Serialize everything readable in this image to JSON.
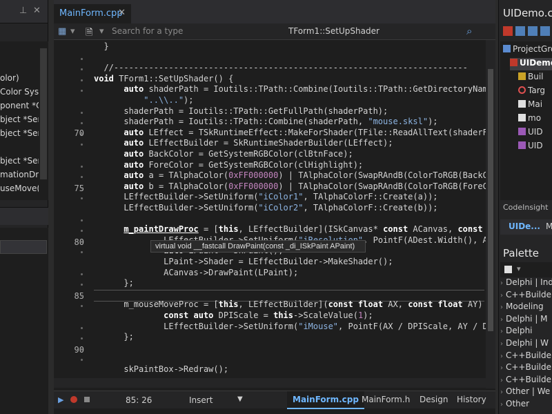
{
  "left_panel": {
    "pin_icon": "pin-icon",
    "close_icon": "close-icon",
    "items": [
      "olor)",
      "Color  Syste",
      "ponent  *Ov",
      "bject  *Sen",
      "bject  *Send",
      "bject  *Send",
      "mationDraw",
      "useMove(T"
    ]
  },
  "editor": {
    "tab_label": "MainForm.cpp",
    "search_placeholder": "Search for a type",
    "method_label": "TForm1::SetUpShader",
    "tooltip": "virtual void __fastcall DrawPaint(const _di_ISkPaint APaint)",
    "line_numbers": [
      "70",
      "75",
      "80",
      "85",
      "90"
    ]
  },
  "code_lines": [
    {
      "segs": [
        [
          "",
          "  }"
        ]
      ]
    },
    {
      "segs": [
        [
          "",
          ""
        ]
      ]
    },
    {
      "segs": [
        [
          "",
          "  //-----------------------------------------------------------------------"
        ]
      ]
    },
    {
      "segs": [
        [
          "kw",
          "void"
        ],
        [
          "",
          " TForm1::SetUpShader() {"
        ]
      ]
    },
    {
      "segs": [
        [
          "",
          "      "
        ],
        [
          "kw",
          "auto"
        ],
        [
          "",
          " shaderPath = Ioutils::TPath::Combine(Ioutils::TPath::GetDirectoryNam"
        ]
      ]
    },
    {
      "segs": [
        [
          "",
          "          "
        ],
        [
          "str",
          "\"..\\\\..\""
        ],
        [
          "",
          ");"
        ]
      ]
    },
    {
      "segs": [
        [
          "",
          "      shaderPath = Ioutils::TPath::GetFullPath(shaderPath);"
        ]
      ]
    },
    {
      "segs": [
        [
          "",
          "      shaderPath = Ioutils::TPath::Combine(shaderPath, "
        ],
        [
          "str",
          "\"mouse.sksl\""
        ],
        [
          "",
          ");"
        ]
      ]
    },
    {
      "segs": [
        [
          "",
          "      "
        ],
        [
          "kw",
          "auto"
        ],
        [
          "",
          " LEffect = TSkRuntimeEffect::MakeForShader(TFile::ReadAllText(shaderF"
        ]
      ]
    },
    {
      "segs": [
        [
          "",
          "      "
        ],
        [
          "kw",
          "auto"
        ],
        [
          "",
          " LEffectBuilder = SkRuntimeShaderBuilder(LEffect);"
        ]
      ]
    },
    {
      "segs": [
        [
          "",
          "      "
        ],
        [
          "kw",
          "auto"
        ],
        [
          "",
          " BackColor = GetSystemRGBColor(clBtnFace);"
        ]
      ]
    },
    {
      "segs": [
        [
          "",
          "      "
        ],
        [
          "kw",
          "auto"
        ],
        [
          "",
          " ForeColor = GetSystemRGBColor(clHighlight);"
        ]
      ]
    },
    {
      "segs": [
        [
          "",
          "      "
        ],
        [
          "kw",
          "auto"
        ],
        [
          "",
          " a = TAlphaColor("
        ],
        [
          "num",
          "0xFF000000"
        ],
        [
          "",
          ") | TAlphaColor(SwapRAndB(ColorToRGB(BackC"
        ]
      ]
    },
    {
      "segs": [
        [
          "",
          "      "
        ],
        [
          "kw",
          "auto"
        ],
        [
          "",
          " b = TAlphaColor("
        ],
        [
          "num",
          "0xFF000000"
        ],
        [
          "",
          ") | TAlphaColor(SwapRAndB(ColorToRGB(ForeC"
        ]
      ]
    },
    {
      "segs": [
        [
          "",
          "      LEffectBuilder->SetUniform("
        ],
        [
          "str",
          "\"iColor1\""
        ],
        [
          "",
          ", TAlphaColorF::Create(a));"
        ]
      ]
    },
    {
      "segs": [
        [
          "",
          "      LEffectBuilder->SetUniform("
        ],
        [
          "str",
          "\"iColor2\""
        ],
        [
          "",
          ", TAlphaColorF::Create(b));"
        ]
      ]
    },
    {
      "segs": [
        [
          "",
          ""
        ]
      ]
    },
    {
      "segs": [
        [
          "",
          "      "
        ],
        [
          "hl",
          "m_paintDrawProc"
        ],
        [
          "",
          " = ["
        ],
        [
          "kw",
          "this"
        ],
        [
          "",
          ", LEffectBuilder](ISkCanvas* "
        ],
        [
          "kw",
          "const"
        ],
        [
          "",
          " ACanvas, "
        ],
        [
          "kw",
          "const"
        ]
      ]
    },
    {
      "segs": [
        [
          "",
          "              LEffectBuilder->SetUniform("
        ],
        [
          "str",
          "\"iResolution\""
        ],
        [
          "",
          ", PointF(ADest.Width(), A"
        ]
      ]
    },
    {
      "segs": [
        [
          "",
          "              "
        ],
        [
          "kw",
          "auto"
        ],
        [
          "",
          " LPaint = SkPaint();"
        ]
      ]
    },
    {
      "segs": [
        [
          "",
          "              LPaint->Shader = LEffectBuilder->MakeShader();"
        ]
      ]
    },
    {
      "segs": [
        [
          "",
          "              ACanvas->DrawPaint(LPaint);"
        ]
      ]
    },
    {
      "segs": [
        [
          "",
          "      };"
        ]
      ]
    },
    {
      "segs": [
        [
          "",
          ""
        ]
      ]
    },
    {
      "segs": [
        [
          "",
          "      m_mouseMoveProc = ["
        ],
        [
          "kw",
          "this"
        ],
        [
          "",
          ", LEffectBuilder]("
        ],
        [
          "kw",
          "const float"
        ],
        [
          "",
          " AX, "
        ],
        [
          "kw",
          "const float"
        ],
        [
          "",
          " AY)"
        ]
      ]
    },
    {
      "segs": [
        [
          "",
          "              "
        ],
        [
          "kw",
          "const auto"
        ],
        [
          "",
          " DPIScale = "
        ],
        [
          "kw",
          "this"
        ],
        [
          "",
          "->ScaleValue("
        ],
        [
          "num",
          "1"
        ],
        [
          "",
          ");"
        ]
      ]
    },
    {
      "segs": [
        [
          "",
          "              LEffectBuilder->SetUniform("
        ],
        [
          "str",
          "\"iMouse\""
        ],
        [
          "",
          ", PointF(AX / DPIScale, AY / D"
        ]
      ]
    },
    {
      "segs": [
        [
          "",
          "      };"
        ]
      ]
    },
    {
      "segs": [
        [
          "",
          ""
        ]
      ]
    },
    {
      "segs": [
        [
          "",
          ""
        ]
      ]
    },
    {
      "segs": [
        [
          "",
          "      skPaintBox->Redraw();"
        ]
      ]
    }
  ],
  "status_bar": {
    "position": "85:  26",
    "mode": "Insert",
    "tabs": [
      "MainForm.cpp",
      "MainForm.h",
      "Design",
      "History"
    ],
    "active_tab": 0
  },
  "right_panel": {
    "title": "UIDemo.cb",
    "tree": [
      "ProjectGro",
      "UIDemo",
      "Buil",
      "Targ",
      "Mai",
      "mo",
      "UID",
      "UID"
    ],
    "codeinsight_label": "CodeInsight",
    "tabs": [
      "UIDe...",
      "M"
    ],
    "palette_title": "Palette",
    "palette_items": [
      "Delphi | Ind",
      "C++Builde",
      "Modeling",
      "Delphi | M",
      "Delphi",
      "Delphi | W",
      "C++Builde",
      "C++Builde",
      "C++Builde",
      "Other | We",
      "Other"
    ]
  },
  "colors": {
    "accent": "#6fb7ff",
    "background": "#1e1e1e",
    "string": "#8db4e2",
    "number": "#c586c0"
  }
}
